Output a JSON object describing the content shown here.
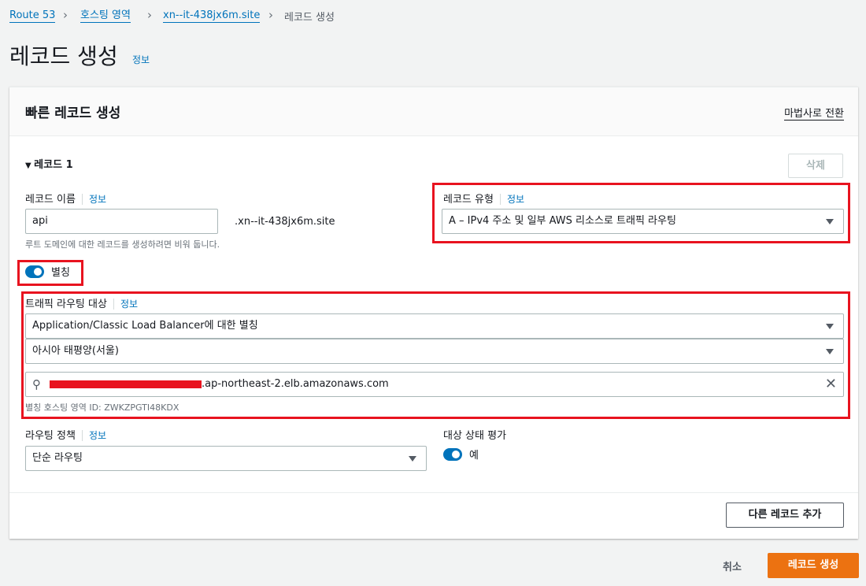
{
  "breadcrumb": [
    "Route 53",
    "호스팅 영역",
    "xn--it-438jx6m.site",
    "레코드 생성"
  ],
  "page": {
    "title": "레코드 생성",
    "info": "정보"
  },
  "panel": {
    "title": "빠른 레코드 생성",
    "wizard_link": "마법사로 전환"
  },
  "record": {
    "section": "레코드 1",
    "delete": "삭제",
    "name_label": "레코드 이름",
    "name_info": "정보",
    "name_value": "api",
    "domain_suffix": ".xn--it-438jx6m.site",
    "name_hint": "루트 도메인에 대한 레코드를 생성하려면 비워 둡니다.",
    "type_label": "레코드 유형",
    "type_info": "정보",
    "type_value": "A – IPv4 주소 및 일부 AWS 리소스로 트래픽 라우팅",
    "alias_label": "별칭",
    "target_label": "트래픽 라우팅 대상",
    "target_info": "정보",
    "target_type": "Application/Classic Load Balancer에 대한 별칭",
    "region": "아시아 태평양(서울)",
    "endpoint_suffix": ".ap-northeast-2.elb.amazonaws.com",
    "zone_id": "별칭 호스팅 영역 ID: ZWKZPGTI48KDX",
    "policy_label": "라우팅 정책",
    "policy_info": "정보",
    "policy_value": "단순 라우팅",
    "health_label": "대상 상태 평가",
    "health_value": "예",
    "add_record": "다른 레코드 추가"
  },
  "footer": {
    "cancel": "취소",
    "create": "레코드 생성"
  },
  "colors": {
    "accent": "#ec7211",
    "link": "#0073bb",
    "highlight": "#e8131f"
  }
}
